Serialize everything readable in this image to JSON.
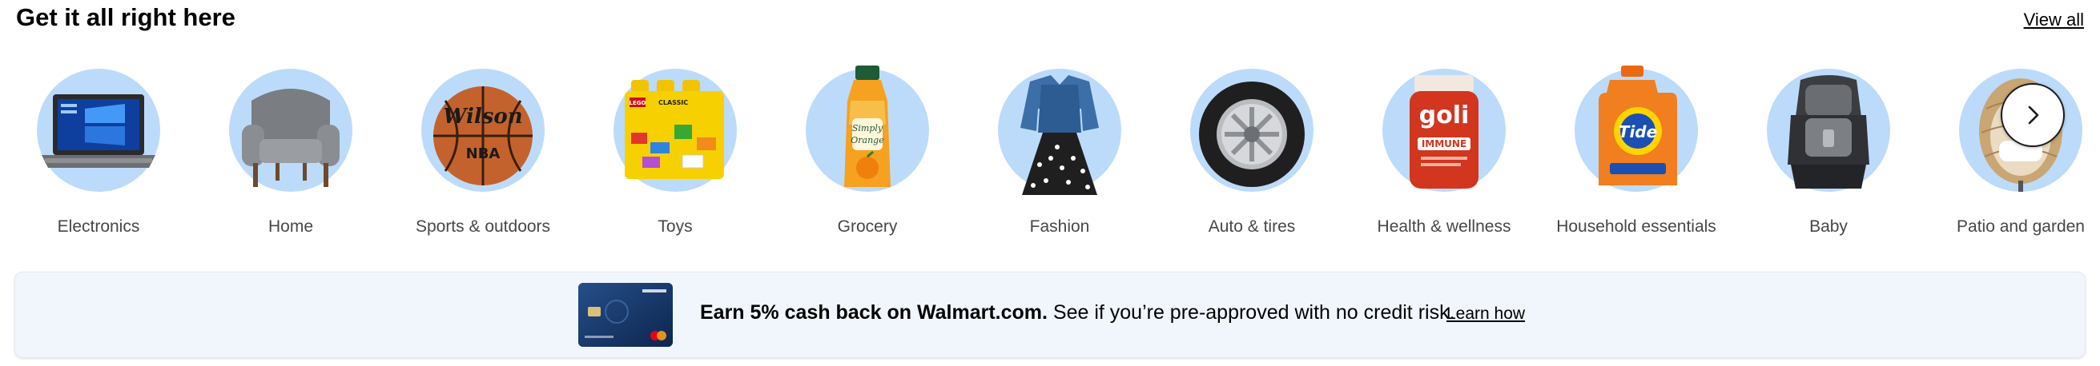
{
  "section": {
    "title": "Get it all right here",
    "view_all": "View all"
  },
  "categories": [
    {
      "label": "Electronics",
      "icon": "laptop-icon"
    },
    {
      "label": "Home",
      "icon": "armchair-icon"
    },
    {
      "label": "Sports & outdoors",
      "icon": "basketball-icon"
    },
    {
      "label": "Toys",
      "icon": "lego-box-icon"
    },
    {
      "label": "Grocery",
      "icon": "juice-bottle-icon"
    },
    {
      "label": "Fashion",
      "icon": "dress-jacket-icon"
    },
    {
      "label": "Auto & tires",
      "icon": "tire-icon"
    },
    {
      "label": "Health & wellness",
      "icon": "vitamin-jar-icon"
    },
    {
      "label": "Household essentials",
      "icon": "detergent-icon"
    },
    {
      "label": "Baby",
      "icon": "car-seat-icon"
    },
    {
      "label": "Patio and garden",
      "icon": "egg-chair-icon"
    }
  ],
  "product_text": {
    "wilson": "Wilson",
    "nba": "NBA",
    "lego": "LEGO",
    "classic": "CLASSIC",
    "simply": "Simply",
    "orange": "Orange",
    "goli": "goli",
    "immune": "IMMUNE",
    "tide": "Tide"
  },
  "banner": {
    "bold_text": "Earn 5% cash back on Walmart.com.",
    "rest_text": " See if you’re pre-approved with no credit risk.",
    "link": "Learn how",
    "card_icon": "capital-one-card-icon"
  },
  "colors": {
    "circle_bg": "#bcdbfb",
    "banner_bg": "#f1f6fd"
  }
}
